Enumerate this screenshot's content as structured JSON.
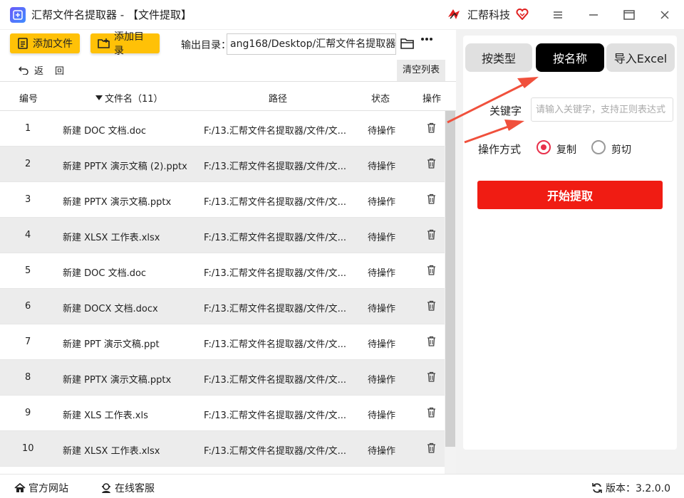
{
  "window": {
    "title": "汇帮文件名提取器 - 【文件提取】",
    "brand_name": "汇帮科技"
  },
  "toolbar": {
    "add_file_label": "添加文件",
    "add_dir_label": "添加目录",
    "output_label": "输出目录：",
    "output_path": "ang168/Desktop/汇帮文件名提取器",
    "back_label": "返回",
    "clear_label": "清空列表"
  },
  "table": {
    "headers": {
      "index": "编号",
      "filename": "文件名（11）",
      "path": "路径",
      "status": "状态",
      "action": "操作"
    },
    "rows": [
      {
        "no": "1",
        "name": "新建 DOC 文档.doc",
        "path": "F:/13.汇帮文件名提取器/文件/文...",
        "status": "待操作"
      },
      {
        "no": "2",
        "name": "新建 PPTX 演示文稿 (2).pptx",
        "path": "F:/13.汇帮文件名提取器/文件/文...",
        "status": "待操作"
      },
      {
        "no": "3",
        "name": "新建 PPTX 演示文稿.pptx",
        "path": "F:/13.汇帮文件名提取器/文件/文...",
        "status": "待操作"
      },
      {
        "no": "4",
        "name": "新建 XLSX 工作表.xlsx",
        "path": "F:/13.汇帮文件名提取器/文件/文...",
        "status": "待操作"
      },
      {
        "no": "5",
        "name": "新建 DOC 文档.doc",
        "path": "F:/13.汇帮文件名提取器/文件/文...",
        "status": "待操作"
      },
      {
        "no": "6",
        "name": "新建 DOCX 文档.docx",
        "path": "F:/13.汇帮文件名提取器/文件/文...",
        "status": "待操作"
      },
      {
        "no": "7",
        "name": "新建 PPT 演示文稿.ppt",
        "path": "F:/13.汇帮文件名提取器/文件/文...",
        "status": "待操作"
      },
      {
        "no": "8",
        "name": "新建 PPTX 演示文稿.pptx",
        "path": "F:/13.汇帮文件名提取器/文件/文...",
        "status": "待操作"
      },
      {
        "no": "9",
        "name": "新建 XLS 工作表.xls",
        "path": "F:/13.汇帮文件名提取器/文件/文...",
        "status": "待操作"
      },
      {
        "no": "10",
        "name": "新建 XLSX 工作表.xlsx",
        "path": "F:/13.汇帮文件名提取器/文件/文...",
        "status": "待操作"
      }
    ]
  },
  "panel": {
    "tabs": [
      {
        "label": "按类型",
        "active": false
      },
      {
        "label": "按名称",
        "active": true
      },
      {
        "label": "导入Excel",
        "active": false
      }
    ],
    "keyword_label": "关键字",
    "keyword_placeholder": "请输入关键字，支持正则表达式",
    "keyword_value": "",
    "operation_label": "操作方式",
    "op_copy": "复制",
    "op_cut": "剪切",
    "selected_op": "copy",
    "start_label": "开始提取"
  },
  "status": {
    "website": "官方网站",
    "support": "在线客服",
    "version": "版本：3.2.0.0"
  },
  "colors": {
    "accent_yellow": "#ffc107",
    "accent_red": "#f01c13",
    "annotation_arrow": "#f0503c"
  },
  "icons": [
    "app-logo-icon",
    "brand-logo-icon",
    "heart-badge-icon",
    "menu-icon",
    "minimize-icon",
    "maximize-icon",
    "close-icon",
    "add-file-icon",
    "add-folder-icon",
    "folder-open-icon",
    "more-icon",
    "back-icon",
    "sort-down-icon",
    "trash-icon",
    "home-icon",
    "support-icon",
    "refresh-icon"
  ]
}
